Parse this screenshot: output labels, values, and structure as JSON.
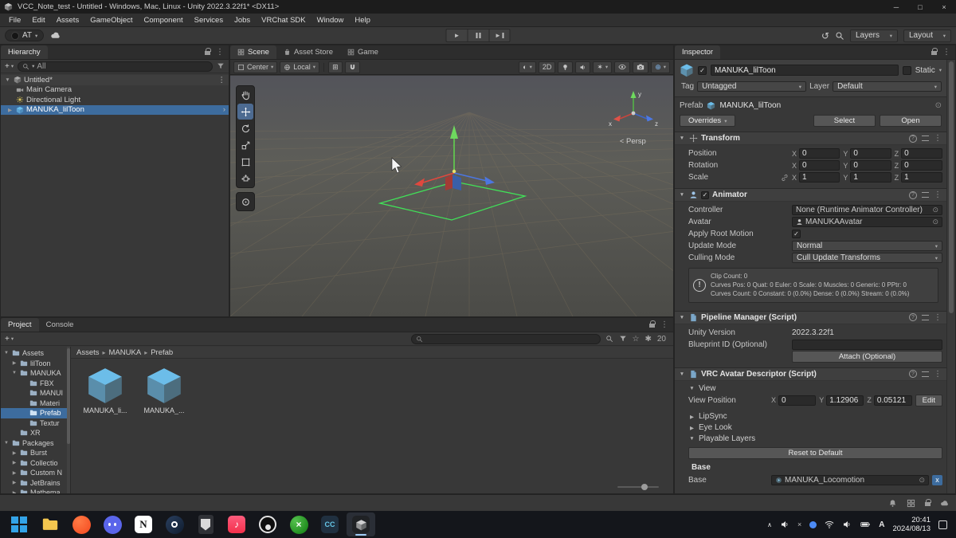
{
  "titlebar": {
    "title": "VCC_Note_test - Untitled - Windows, Mac, Linux - Unity 2022.3.22f1* <DX11>"
  },
  "menubar": {
    "items": [
      "File",
      "Edit",
      "Assets",
      "GameObject",
      "Component",
      "Services",
      "Jobs",
      "VRChat SDK",
      "Window",
      "Help"
    ]
  },
  "toolbar": {
    "account_label": "AT",
    "layers_label": "Layers",
    "layout_label": "Layout"
  },
  "icons": {
    "dropdown_caret": "▾",
    "fold_open": "▼",
    "fold_closed": "▶",
    "menu_dots": "⋮",
    "plus": "+",
    "chevron_right": "›",
    "breadcrumb_sep": "▸",
    "minimize": "─",
    "maximize": "□",
    "close": "×",
    "play": "►",
    "sphere": "◐",
    "effects": "✶",
    "gizmo_target": "⊕",
    "undo_history": "↺",
    "check": "✓",
    "picker": "⊙",
    "chevron_up": "∧",
    "small_x": "×",
    "grid_snap": "⊞",
    "star": "☆",
    "sparkle": "✱",
    "help": "?",
    "music_note": "♪",
    "letter_x": "×",
    "exclaim": "!"
  },
  "hierarchy": {
    "tab_label": "Hierarchy",
    "search_text": "All",
    "scene_name": "Untitled*",
    "items": [
      {
        "label": "Main Camera"
      },
      {
        "label": "Directional Light"
      },
      {
        "label": "MANUKA_lilToon"
      }
    ]
  },
  "scene_view": {
    "tab_scene": "Scene",
    "tab_asset_store": "Asset Store",
    "tab_game": "Game",
    "pivot_label": "Center",
    "space_label": "Local",
    "mode_2d": "2D",
    "persp_chevron": "<",
    "persp_label": "Persp",
    "axis_labels": {
      "x": "x",
      "y": "y",
      "z": "z"
    }
  },
  "project": {
    "tab_project": "Project",
    "tab_console": "Console",
    "hidden_count": "20",
    "breadcrumb": [
      "Assets",
      "MANUKA",
      "Prefab"
    ],
    "tree": [
      {
        "label": "Assets"
      },
      {
        "label": "lilToon"
      },
      {
        "label": "MANUKA"
      },
      {
        "label": "FBX"
      },
      {
        "label": "MANUI"
      },
      {
        "label": "Materi"
      },
      {
        "label": "Prefab"
      },
      {
        "label": "Textur"
      },
      {
        "label": "XR"
      },
      {
        "label": "Packages"
      },
      {
        "label": "Burst"
      },
      {
        "label": "Collectio"
      },
      {
        "label": "Custom N"
      },
      {
        "label": "JetBrains"
      },
      {
        "label": "Mathema"
      }
    ],
    "files": [
      {
        "label": "MANUKA_li..."
      },
      {
        "label": "MANUKA_..."
      }
    ]
  },
  "inspector": {
    "tab_label": "Inspector",
    "name": "MANUKA_lilToon",
    "static_label": "Static",
    "tag_label": "Tag",
    "tag_value": "Untagged",
    "layer_label": "Layer",
    "layer_value": "Default",
    "prefab_label": "Prefab",
    "prefab_name": "MANUKA_lilToon",
    "overrides_label": "Overrides",
    "select_label": "Select",
    "open_label": "Open",
    "transform": {
      "title": "Transform",
      "position_label": "Position",
      "rotation_label": "Rotation",
      "scale_label": "Scale",
      "axis_x": "X",
      "axis_y": "Y",
      "axis_z": "Z",
      "position": {
        "x": "0",
        "y": "0",
        "z": "0"
      },
      "rotation": {
        "x": "0",
        "y": "0",
        "z": "0"
      },
      "scale": {
        "x": "1",
        "y": "1",
        "z": "1"
      }
    },
    "animator": {
      "title": "Animator",
      "controller_label": "Controller",
      "controller_value": "None (Runtime Animator Controller)",
      "avatar_label": "Avatar",
      "avatar_value": "MANUKAAvatar",
      "apply_root_motion_label": "Apply Root Motion",
      "update_mode_label": "Update Mode",
      "update_mode_value": "Normal",
      "culling_mode_label": "Culling Mode",
      "culling_mode_value": "Cull Update Transforms",
      "info_line1": "Clip Count: 0",
      "info_line2": "Curves Pos: 0 Quat: 0 Euler: 0 Scale: 0 Muscles: 0 Generic: 0 PPtr: 0",
      "info_line3": "Curves Count: 0 Constant: 0 (0.0%) Dense: 0 (0.0%) Stream: 0 (0.0%)"
    },
    "pipeline": {
      "title": "Pipeline Manager (Script)",
      "unity_version_label": "Unity Version",
      "unity_version_value": "2022.3.22f1",
      "blueprint_label": "Blueprint ID (Optional)",
      "attach_button": "Attach (Optional)"
    },
    "descriptor": {
      "title": "VRC Avatar Descriptor (Script)",
      "view_label": "View",
      "view_position_label": "View Position",
      "axis_x": "X",
      "axis_y": "Y",
      "axis_z": "Z",
      "x": "0",
      "y": "1.12906",
      "z": "0.05121",
      "edit_button": "Edit",
      "lipsync_label": "LipSync",
      "eyelook_label": "Eye Look",
      "playable_label": "Playable Layers",
      "reset_button": "Reset to Default",
      "base_section_label": "Base",
      "base_label": "Base",
      "base_value": "MANUKA_Locomotion",
      "remove_label": "x"
    }
  },
  "taskbar": {
    "time": "20:41",
    "date": "2024/08/13",
    "ime_label": "A",
    "notion_label": "N",
    "cc_label": "CC"
  }
}
